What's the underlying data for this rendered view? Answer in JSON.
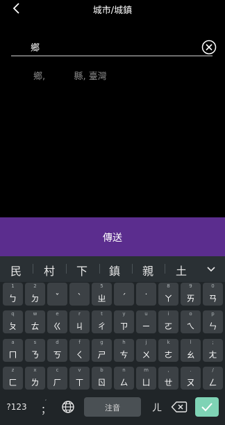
{
  "header": {
    "title": "城市/城鎮"
  },
  "search": {
    "value": "鄉"
  },
  "suggestion": {
    "text": "鄉,          縣, 臺灣"
  },
  "send_button": {
    "label": "傳送"
  },
  "candidates": [
    "民",
    "村",
    "下",
    "鎮",
    "親",
    "土"
  ],
  "keyboard": {
    "rows": [
      [
        {
          "hint": "1",
          "glyph": "ㄅ"
        },
        {
          "hint": "2",
          "glyph": "ㄉ"
        },
        {
          "hint": "",
          "glyph": "ˇ"
        },
        {
          "hint": "",
          "glyph": "ˋ"
        },
        {
          "hint": "5",
          "glyph": "ㄓ"
        },
        {
          "hint": "",
          "glyph": "ˊ"
        },
        {
          "hint": "",
          "glyph": "˙"
        },
        {
          "hint": "8",
          "glyph": "ㄚ"
        },
        {
          "hint": "9",
          "glyph": "ㄞ"
        },
        {
          "hint": "0",
          "glyph": "ㄢ"
        }
      ],
      [
        {
          "hint": "q",
          "glyph": "ㄆ"
        },
        {
          "hint": "w",
          "glyph": "ㄊ"
        },
        {
          "hint": "e",
          "glyph": "ㄍ"
        },
        {
          "hint": "r",
          "glyph": "ㄐ"
        },
        {
          "hint": "t",
          "glyph": "ㄔ"
        },
        {
          "hint": "y",
          "glyph": "ㄗ"
        },
        {
          "hint": "u",
          "glyph": "ㄧ"
        },
        {
          "hint": "i",
          "glyph": "ㄛ"
        },
        {
          "hint": "o",
          "glyph": "ㄟ"
        },
        {
          "hint": "p",
          "glyph": "ㄣ"
        }
      ],
      [
        {
          "hint": "a",
          "glyph": "ㄇ"
        },
        {
          "hint": "s",
          "glyph": "ㄋ"
        },
        {
          "hint": "d",
          "glyph": "ㄎ"
        },
        {
          "hint": "f",
          "glyph": "ㄑ"
        },
        {
          "hint": "g",
          "glyph": "ㄕ"
        },
        {
          "hint": "h",
          "glyph": "ㄘ"
        },
        {
          "hint": "j",
          "glyph": "ㄨ"
        },
        {
          "hint": "k",
          "glyph": "ㄜ"
        },
        {
          "hint": "l",
          "glyph": "ㄠ"
        },
        {
          "hint": ";",
          "glyph": "ㄤ"
        }
      ],
      [
        {
          "hint": "z",
          "glyph": "ㄈ"
        },
        {
          "hint": "x",
          "glyph": "ㄌ"
        },
        {
          "hint": "c",
          "glyph": "ㄏ"
        },
        {
          "hint": "v",
          "glyph": "ㄒ"
        },
        {
          "hint": "b",
          "glyph": "ㄖ"
        },
        {
          "hint": "n",
          "glyph": "ㄙ"
        },
        {
          "hint": "m",
          "glyph": "ㄩ"
        },
        {
          "hint": ",",
          "glyph": "ㄝ"
        },
        {
          "hint": ".",
          "glyph": "ㄡ"
        },
        {
          "hint": "/",
          "glyph": "ㄥ"
        }
      ]
    ],
    "bottom": {
      "symbols_label": "?123",
      "punct_hint": ",",
      "punct_label": "；",
      "space_label": "注音",
      "er_label": "ㄦ"
    }
  },
  "colors": {
    "send_bar": "#5b2d8e",
    "enter_key": "#7fd3b5",
    "keyboard_bg": "#202528",
    "key_bg": "#3c4145"
  },
  "icons": [
    "back-arrow-icon",
    "clear-circle-x-icon",
    "chevron-down-icon",
    "globe-icon",
    "backspace-icon",
    "check-icon"
  ]
}
